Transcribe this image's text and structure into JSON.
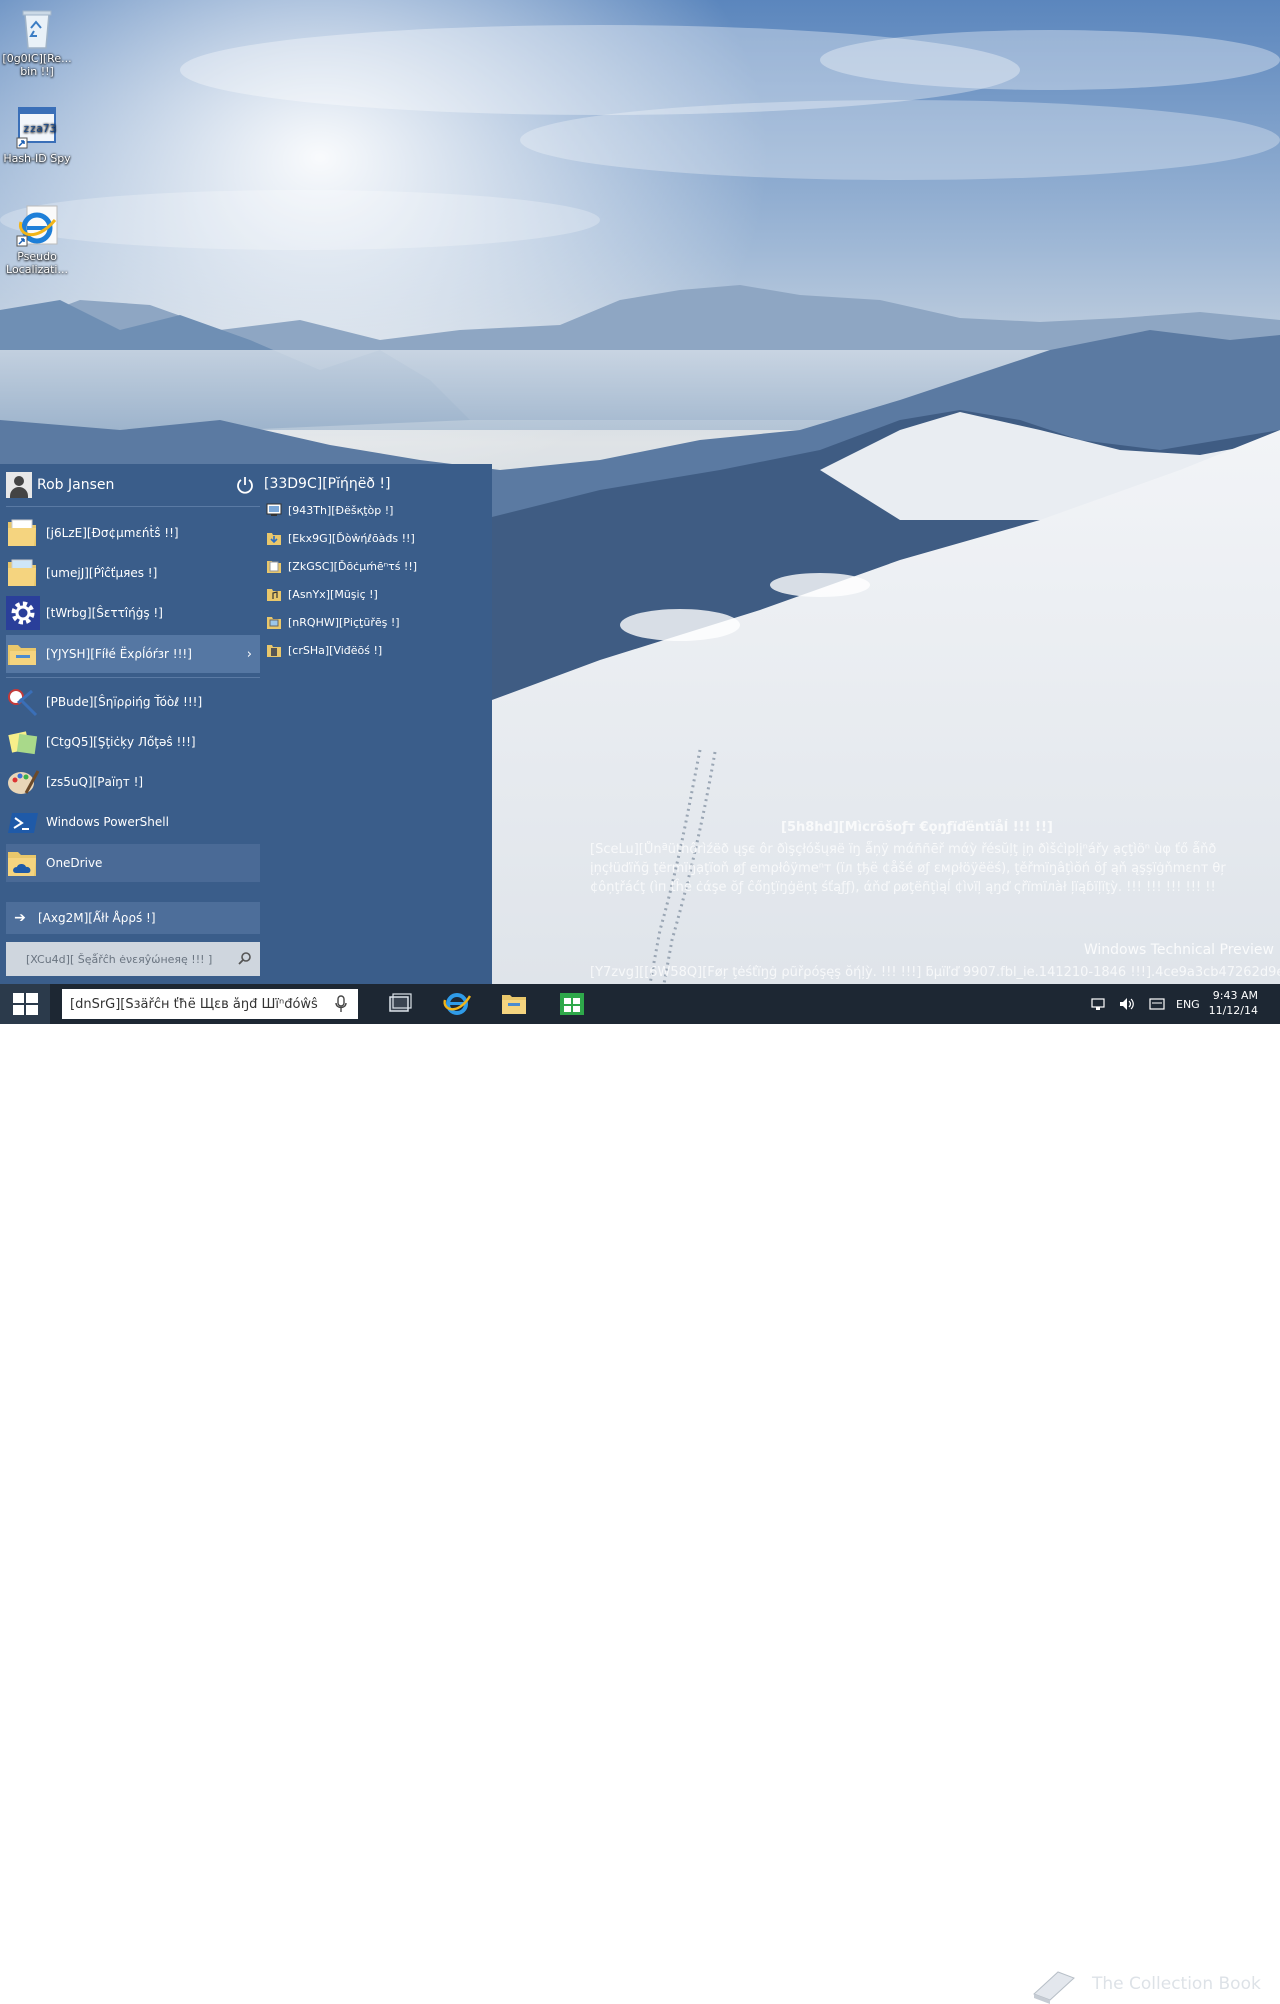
{
  "desktop": {
    "icons": [
      {
        "label": "[0g0IC][Re... bin !!]",
        "icon": "recycle-bin-icon"
      },
      {
        "label": "Hash-ID Spy",
        "icon": "hash-id-spy-icon"
      },
      {
        "label": "Pseudo Localizati...",
        "icon": "internet-explorer-icon"
      }
    ]
  },
  "start_menu": {
    "user_name": "Rob Jansen",
    "power_icon": "power-icon",
    "left_items": [
      {
        "label": "[j6LzE][Ðσ¢μmεńṫŝ !!]",
        "icon": "documents-folder-icon"
      },
      {
        "label": "[umejJ][Ṕîĉťμяes !]",
        "icon": "pictures-folder-icon"
      },
      {
        "label": "[tWrbg][Ŝεττîήġş !]",
        "icon": "settings-gear-icon"
      },
      {
        "label": "[YJYSH][Fíłé Ëxρĺóŕзr !!!]",
        "icon": "file-explorer-icon",
        "chevron": "›"
      },
      {
        "label": "[PBude][Ŝηïρρiήg Ťóòℓ !!!]",
        "icon": "snipping-tool-icon"
      },
      {
        "label": "[CtgQ5][Şţiċķy Лőţəŝ !!!]",
        "icon": "sticky-notes-icon"
      },
      {
        "label": "[zs5uQ][Ρaïŋт !]",
        "icon": "paint-icon"
      },
      {
        "label": "Windows PowerShell",
        "icon": "powershell-icon"
      },
      {
        "label": "OneDrive",
        "icon": "onedrive-icon"
      }
    ],
    "all_apps": "[Axg2M][Ǻłŀ Åρρś !]",
    "search_placeholder": "[XCu4d][ Šęǻřĉh ėνεяŷώнеяę !!! ]",
    "right_title": "[33D9C][Ρĭήηёð !]",
    "right_items": [
      {
        "label": "[943Th][Ðёšқţòp !]",
        "icon": "desktop-icon"
      },
      {
        "label": "[Ekx9G][Ďòŵήℓōàđs !!]",
        "icon": "downloads-folder-icon"
      },
      {
        "label": "[ZkGSC][Ďōċμḿēⁿτś !!]",
        "icon": "documents-folder-icon"
      },
      {
        "label": "[AsnYx][Mũşiç !]",
        "icon": "music-folder-icon"
      },
      {
        "label": "[nRQHW][Ρiçţũřēş !]",
        "icon": "pictures-folder-icon"
      },
      {
        "label": "[crSHa][Viđёōś !]",
        "icon": "videos-folder-icon"
      }
    ]
  },
  "watermark": {
    "title": "[5h8hd][Mìcrõšoƒт €ǫŋƒïďёntïåĺ !!! !!]",
    "body": "[SceLu][Ůnªüthôrìźëð ųşє ôr ðìşçłóšųяë ïŋ ǻņÿ mάññēř mάỳ řésŭļţ įņ ðìšċìpļįⁿářy ạçţìöⁿ ùφ ťő ǻňð įņçłüďïňğ ţërmïŋạţïοň øƒ emρłôÿmeⁿт (ïл ţђё ¢åšé øƒ εмρłöÿëёś), ţěřmïŋâţìŏń ŏƒ ąň ąşşïġňmεnт θŗ ¢ôņţřáćţ (ìп ťĥё ċάşe ŏƒ ĉőŋţïŋġëņţ śťąƒƒ), άňď ρøţëñţìąĺ ¢ìνïļ ąŋď ςřïmïлàł ļïąɓïļïţỳ. !!! !!! !!! !!! !!",
    "preview": "Windows Technical Preview",
    "build": "[Y7zvg][[6W58Q][Føŗ ţėśťïŋġ ρũřρóşęş ŏήļỳ. !!! !!!] ƃµïľď 9907.fbl_ie.141210-1846 !!!].4ce9a3cb47262d9e"
  },
  "taskbar": {
    "search_placeholder": "[dnSrG][Šзäřĉн ťħё Щεв ǻŋđ Шïⁿđóŵŝ",
    "mic_icon": "microphone-icon",
    "apps": [
      "task-view-icon",
      "internet-explorer-icon",
      "file-explorer-icon",
      "store-icon"
    ],
    "tray": {
      "language": "ENG",
      "time": "9:43 AM",
      "date": "11/12/14"
    },
    "overlay_logo": "The Collection Book"
  }
}
